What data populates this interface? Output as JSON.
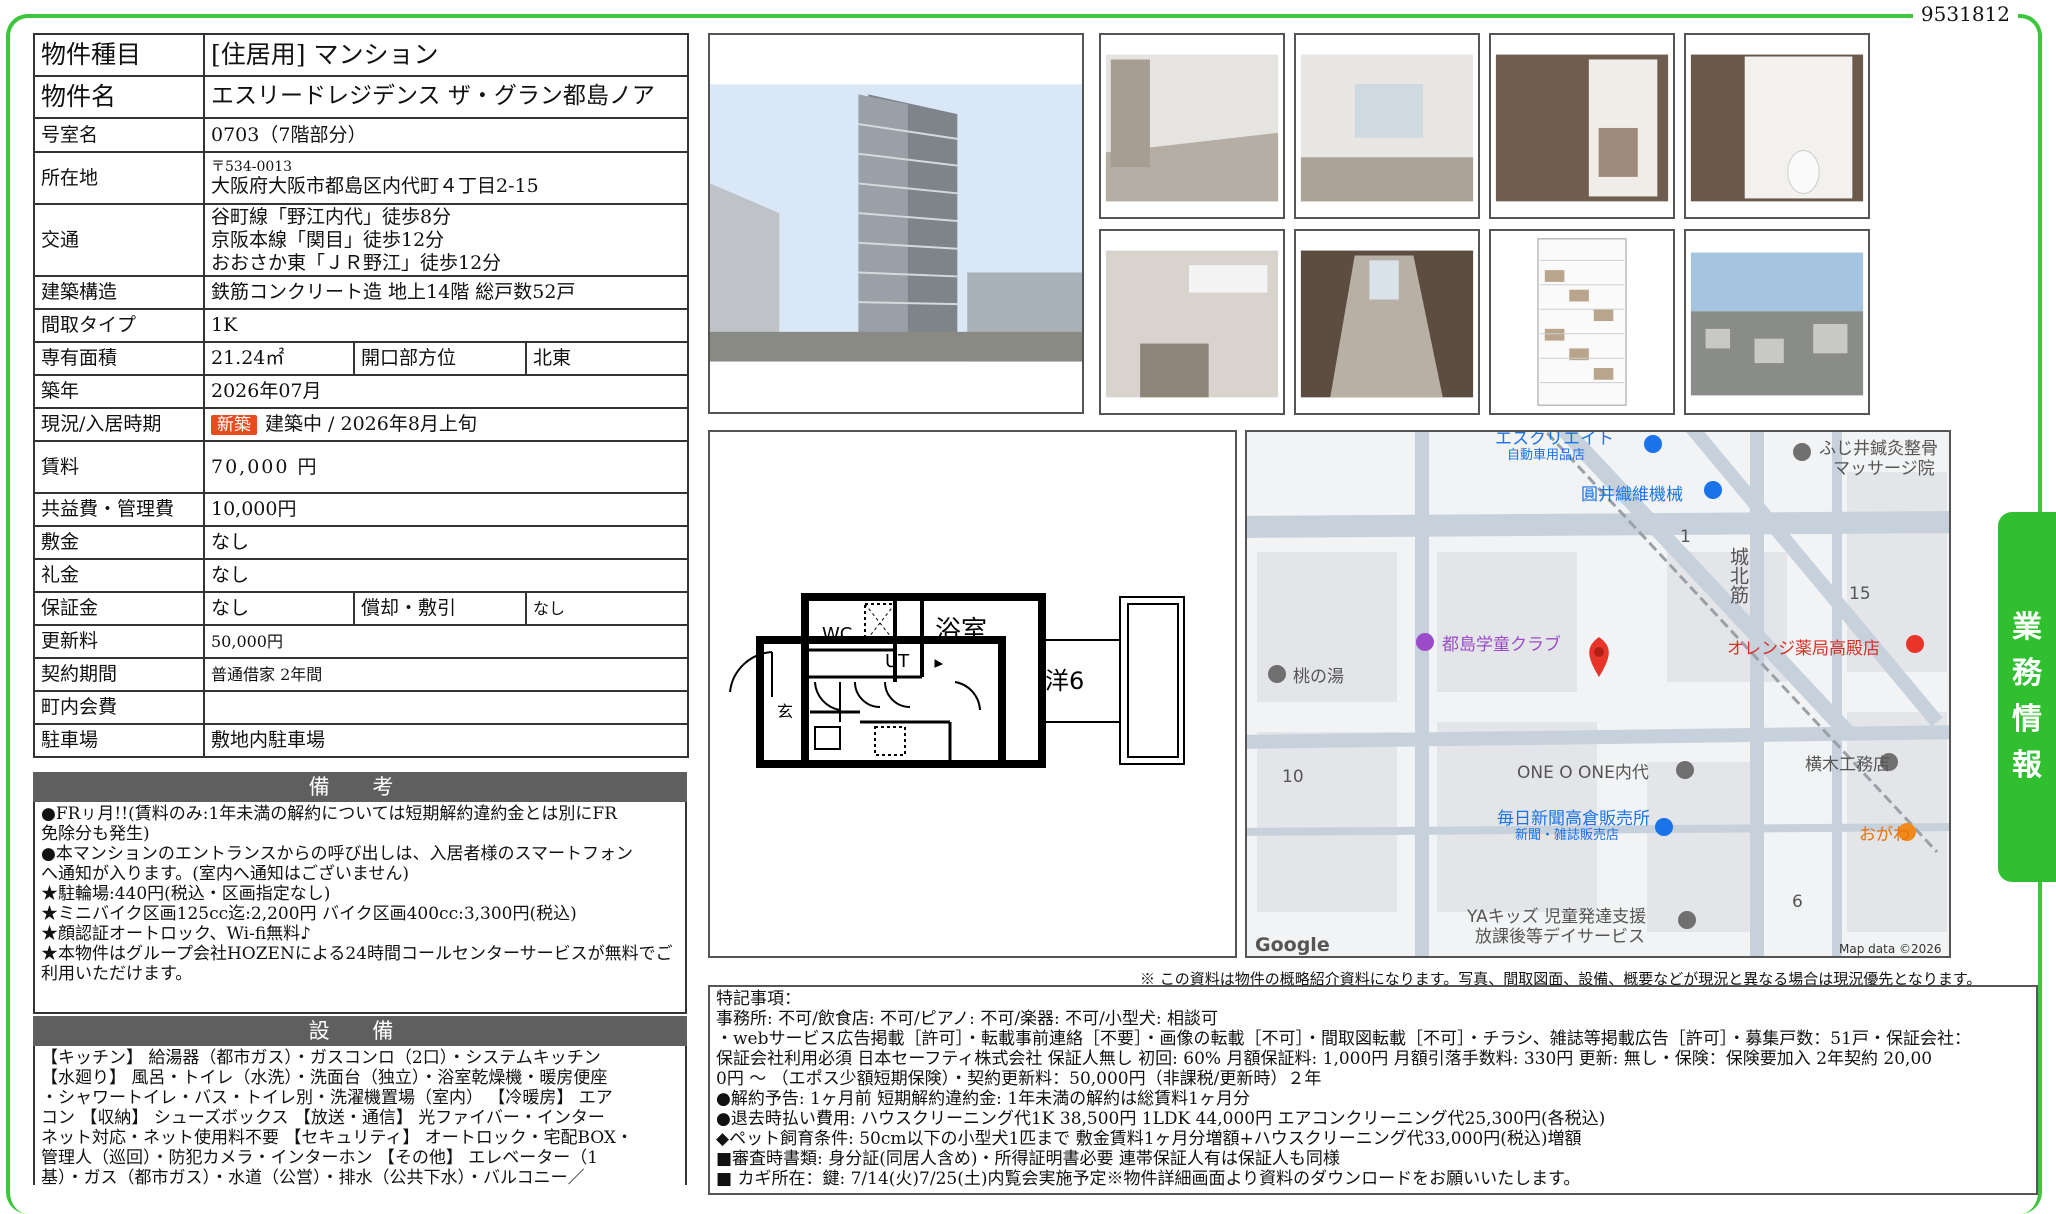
{
  "doc_id": "9531812",
  "property": {
    "type_label": "物件種目",
    "type_value": "[住居用]  マンション",
    "name_label": "物件名",
    "name_value": "エスリードレジデンス ザ・グラン都島ノア",
    "room_label": "号室名",
    "room_value": "0703（7階部分）",
    "address_label": "所在地",
    "postal": "〒534-0013",
    "address": "大阪府大阪市都島区内代町４丁目2-15",
    "access_label": "交通",
    "access": [
      "谷町線「野江内代」徒歩8分",
      "京阪本線「関目」徒歩12分",
      "おおさか東「ＪＲ野江」徒歩12分"
    ],
    "structure_label": "建築構造",
    "structure_value": "鉄筋コンクリート造 地上14階 総戸数52戸",
    "layout_label": "間取タイプ",
    "layout_value": "1K",
    "area_label": "専有面積",
    "area_value": "21.24㎡",
    "opening_label": "開口部方位",
    "opening_value": "北東",
    "built_label": "築年",
    "built_value": "2026年07月",
    "status_label": "現況/入居時期",
    "status_badge": "新築",
    "status_value": "建築中  /   2026年8月上旬",
    "rent_label": "賃料",
    "rent_value": "70,000 円",
    "fee_label": "共益費・管理費",
    "fee_value": "10,000円",
    "deposit_label": "敷金",
    "deposit_value": "なし",
    "key_label": "礼金",
    "key_value": "なし",
    "guarantee_label": "保証金",
    "guarantee_value": "なし",
    "amort_label": "償却・敷引",
    "amort_value": "なし",
    "renewal_label": "更新料",
    "renewal_value": "50,000円",
    "contract_label": "契約期間",
    "contract_value": "普通借家 2年間",
    "community_label": "町内会費",
    "community_value": "",
    "parking_label": "駐車場",
    "parking_value": "敷地内駐車場"
  },
  "remarks": {
    "title": "備 考",
    "lines": [
      "●FRㇼ月!!(賃料のみ:1年未満の解約については短期解約違約金とは別にFR",
      "免除分も発生)",
      "●本マンションのエントランスからの呼び出しは、入居者様のスマートフォン",
      "へ通知が入ります。(室内へ通知はございません)",
      "★駐輪場:440円(税込・区画指定なし)",
      "★ミニバイク区画125cc迄:2,200円      バイク区画400cc:3,300円(税込)",
      "★顔認証オートロック、Wi-fi無料♪",
      "★本物件はグループ会社HOZENによる24時間コールセンターサービスが無料でご",
      "利用いただけます。"
    ]
  },
  "equipment": {
    "title": "設 備",
    "lines": [
      "【キッチン】 給湯器（都市ガス）・ガスコンロ（2口）・システムキッチン",
      "【水廻り】 風呂・トイレ（水洗）・洗面台（独立）・浴室乾燥機・暖房便座",
      "・シャワートイレ・バス・トイレ別・洗濯機置場（室内）  【冷暖房】 エア",
      "コン 【収納】 シューズボックス 【放送・通信】 光ファイバー・インター",
      "ネット対応・ネット使用料不要 【セキュリティ】 オートロック・宅配BOX・",
      "管理人（巡回）・防犯カメラ・インターホン 【その他】 エレベーター（1",
      "基）・ガス（都市ガス）・水道（公営）・排水（公共下水）・バルコニー／"
    ]
  },
  "floorplan": {
    "bath": "浴室",
    "wc": "WC",
    "ut": "UT",
    "room": "洋6",
    "entrance": "玄"
  },
  "map": {
    "labels": [
      "エスクリエイト",
      "自動車用品店",
      "ふじ井鍼灸整骨",
      "マッサージ院",
      "圓井織維機械",
      "都島学童クラブ",
      "オレンジ薬局高殿店",
      "桃の湯",
      "ONE O ONE内代",
      "横木工務店",
      "毎日新聞高倉販売所",
      "新聞・雑誌販売店",
      "おがわ",
      "YAキッズ 児童発達支援",
      "放課後等デイサービス",
      "城北筋",
      "Google",
      "Map data ©2026",
      "1",
      "15",
      "10",
      "6"
    ]
  },
  "disclaimer": "※ この資料は物件の概略紹介資料になります。写真、間取図面、設備、概要などが現況と異なる場合は現況優先となります。",
  "notes": [
    "特記事項：",
    "事務所: 不可/飲食店: 不可/ピアノ: 不可/楽器: 不可/小型犬: 相談可",
    "・webサービス広告掲載［許可］・転載事前連絡［不要］・画像の転載［不可］・間取図転載［不可］・チラシ、雑誌等掲載広告［許可］・募集戸数：51戸・保証会社：",
    "保証会社利用必須 日本セーフティ株式会社 保証人無し    初回: 60%  月額保証料: 1,000円    月額引落手数料: 330円    更新: 無し・保険：保険要加入 2年契約 20,00",
    "0円 ～  （エポス少額短期保険）・契約更新料：50,000円（非課税/更新時）２年",
    "●解約予告: 1ヶ月前        短期解約違約金: 1年未満の解約は総賃料1ヶ月分",
    "●退去時払い費用: ハウスクリーニング代1K 38,500円    1LDK 44,000円        エアコンクリーニング代25,300円(各税込)",
    "◆ペット飼育条件: 50cm以下の小型犬1匹まで    敷金賃料1ヶ月分増額+ハウスクリーニング代33,000円(税込)増額",
    "■審査時書類: 身分証(同居人含め)・所得証明書必要   連帯保証人有は保証人も同様",
    "■ カギ所在：鍵: 7/14(火)7/25(土)内覧会実施予定※物件詳細画面より資料のダウンロードをお願いいたします。"
  ],
  "side_tab": [
    "業",
    "務",
    "情",
    "報"
  ],
  "photos": [
    "building-exterior",
    "room-photo-1",
    "room-photo-2",
    "washroom",
    "toilet",
    "kitchen",
    "hallway",
    "spec-sheet",
    "view-photo"
  ],
  "colors": {
    "frame": "#3cc63c",
    "badge": "#e84b1e",
    "section_head": "#5f5f5f"
  }
}
